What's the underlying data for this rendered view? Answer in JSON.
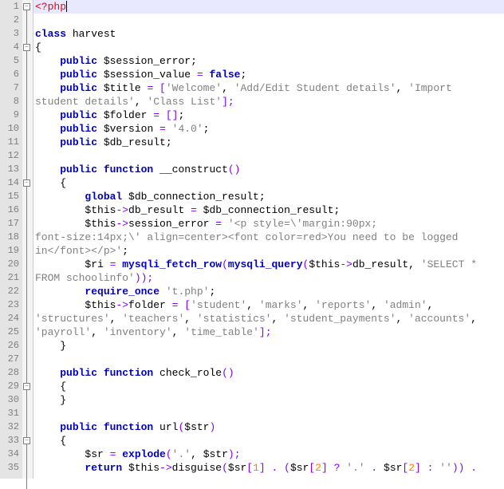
{
  "gutter_numbers": [
    "1",
    "2",
    "3",
    "4",
    "5",
    "6",
    "7",
    "8",
    "9",
    "10",
    "11",
    "12",
    "13",
    "14",
    "15",
    "16",
    "17",
    "18",
    "19",
    "20",
    "21",
    "22",
    "23",
    "24",
    "25",
    "26",
    "27",
    "28",
    "29",
    "30",
    "31",
    "32",
    "33",
    "34",
    "35"
  ],
  "code": {
    "l1": {
      "open_tag": "<?php"
    },
    "l3": {
      "kw_class": "class",
      "name": " harvest"
    },
    "l4": {
      "brace": "{"
    },
    "l5": {
      "kw": "public",
      "var": " $session_error",
      "end": ";"
    },
    "l6": {
      "kw": "public",
      "var": " $session_value ",
      "op": "= ",
      "kw2": "false",
      "end": ";"
    },
    "l7": {
      "kw": "public",
      "var": " $title ",
      "op": "= [",
      "s1": "'Welcome'",
      "c1": ", ",
      "s2": "'Add/Edit Student details'",
      "c2": ", ",
      "s3": "'Import "
    },
    "l8": {
      "s1": "student details'",
      "c1": ", ",
      "s2": "'Class List'",
      "end": "];"
    },
    "l9": {
      "kw": "public",
      "var": " $folder ",
      "op": "= []",
      "end": ";"
    },
    "l10": {
      "kw": "public",
      "var": " $version ",
      "op": "= ",
      "s": "'4.0'",
      "end": ";"
    },
    "l11": {
      "kw": "public",
      "var": " $db_result",
      "end": ";"
    },
    "l13": {
      "kw": "public function",
      "name": " __construct",
      "paren": "()"
    },
    "l14": {
      "brace": "{"
    },
    "l15": {
      "kw": "global",
      "var": " $db_connection_result",
      "end": ";"
    },
    "l16": {
      "var": "$this",
      "op1": "->",
      "prop": "db_result ",
      "op2": "= ",
      "var2": "$db_connection_result",
      "end": ";"
    },
    "l17": {
      "var": "$this",
      "op1": "->",
      "prop": "session_error ",
      "op2": "= ",
      "s": "'<p style=\\'margin:90px; "
    },
    "l18": {
      "s": "font-size:14px;\\' align=center><font color=red>You need to be logged "
    },
    "l19": {
      "s": "in</font></p>'",
      "end": ";"
    },
    "l20": {
      "var": "$ri ",
      "op": "= ",
      "fn": "mysqli_fetch_row",
      "p1": "(",
      "fn2": "mysqli_query",
      "p2": "(",
      "var2": "$this",
      "op2": "->",
      "prop": "db_result",
      "c": ", ",
      "s": "'SELECT * "
    },
    "l21": {
      "s": "FROM schoolinfo'",
      "end": "));"
    },
    "l22": {
      "kw": "require_once ",
      "s": "'t.php'",
      "end": ";"
    },
    "l23": {
      "var": "$this",
      "op1": "->",
      "prop": "folder ",
      "op2": "= [",
      "s1": "'student'",
      "c1": ", ",
      "s2": "'marks'",
      "c2": ", ",
      "s3": "'reports'",
      "c3": ", ",
      "s4": "'admin'",
      "c4": ", "
    },
    "l24": {
      "s1": "'structures'",
      "c1": ", ",
      "s2": "'teachers'",
      "c2": ", ",
      "s3": "'statistics'",
      "c3": ", ",
      "s4": "'student_payments'",
      "c4": ", ",
      "s5": "'accounts'",
      "c5": ", "
    },
    "l25": {
      "s1": "'payroll'",
      "c1": ", ",
      "s2": "'inventory'",
      "c2": ", ",
      "s3": "'time_table'",
      "end": "];"
    },
    "l26": {
      "brace": "}"
    },
    "l28": {
      "kw": "public function",
      "name": " check_role",
      "paren": "()"
    },
    "l29": {
      "brace": "{"
    },
    "l30": {
      "brace": "}"
    },
    "l32": {
      "kw": "public function",
      "name": " url",
      "paren": "(",
      "var": "$str",
      "paren2": ")"
    },
    "l33": {
      "brace": "{"
    },
    "l34": {
      "var": "$sr ",
      "op": "= ",
      "fn": "explode",
      "p": "(",
      "s": "'.'",
      "c": ", ",
      "var2": "$str",
      "end": ");"
    },
    "l35": {
      "kw": "return ",
      "var": "$this",
      "op1": "->",
      "fn": "disguise",
      "p": "(",
      "var2": "$sr",
      "br1": "[",
      "n1": "1",
      "br2": "] ",
      "op2": ". (",
      "var3": "$sr",
      "br3": "[",
      "n2": "2",
      "br4": "] ",
      "op3": "? ",
      "s1": "'.' ",
      "op4": ". ",
      "var4": "$sr",
      "br5": "[",
      "n3": "2",
      "br6": "] ",
      "op5": ": ",
      "s2": "''",
      "end": ")) ."
    }
  }
}
